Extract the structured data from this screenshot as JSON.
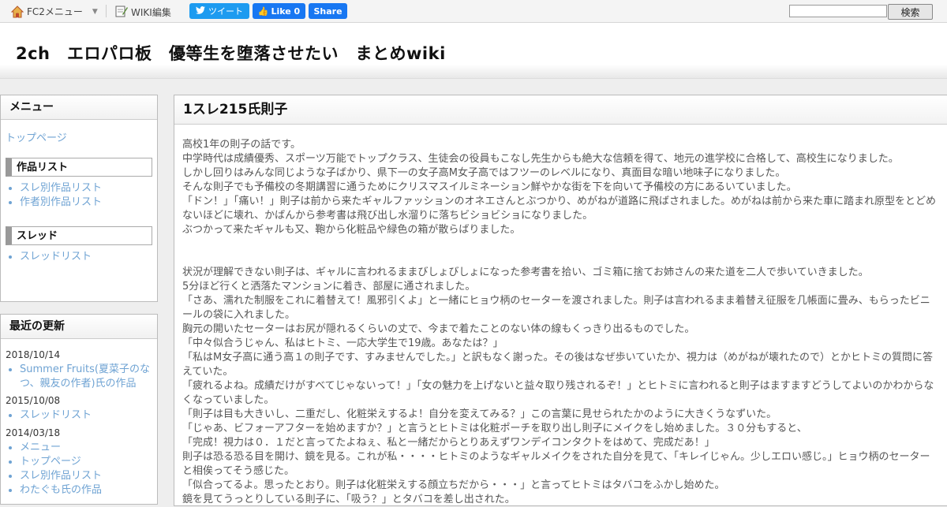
{
  "topbar": {
    "fc2menu_label": "FC2メニュー",
    "wiki_edit_label": "WIKI編集",
    "tweet_label": "ツイート",
    "like_label": "Like 0",
    "share_label": "Share",
    "search_value": "",
    "search_button_label": "検索"
  },
  "header": {
    "site_title": "2ch　エロパロ板　優等生を堕落させたい　まとめwiki"
  },
  "sidebar": {
    "menu_title": "メニュー",
    "top_page_link": "トップページ",
    "works_heading": "作品リスト",
    "works_links": [
      "スレ別作品リスト",
      "作者別作品リスト"
    ],
    "thread_heading": "スレッド",
    "thread_links": [
      "スレッドリスト"
    ],
    "recent_title": "最近の更新",
    "recent": [
      {
        "date": "2018/10/14",
        "items": [
          "Summer Fruits(夏菜子のなつ、親友の作者)氏の作品"
        ]
      },
      {
        "date": "2015/10/08",
        "items": [
          "スレッドリスト"
        ]
      },
      {
        "date": "2014/03/18",
        "items": [
          "メニュー",
          "トップページ",
          "スレ別作品リスト",
          "わたぐも氏の作品"
        ]
      }
    ]
  },
  "main": {
    "title": "1スレ215氏則子",
    "paragraphs_a": [
      "高校1年の則子の話です。",
      "中学時代は成績優秀、スポーツ万能でトップクラス、生徒会の役員もこなし先生からも絶大な信頼を得て、地元の進学校に合格して、高校生になりました。",
      "しかし回りはみんな同じような子ばかり、県下一の女子高M女子高ではフツーのレベルになり、真面目な暗い地味子になりました。",
      "そんな則子でも予備校の冬期講習に通うためにクリスマスイルミネーション鮮やかな街を下を向いて予備校の方にあるいていました。",
      "「ドン！」「痛い！」則子は前から来たギャルファッションのオネエさんとぶつかり、めがねが道路に飛ばされました。めがねは前から来た車に踏まれ原型をとどめないほどに壊れ、かばんから参考書は飛び出し水溜りに落ちビショビショになりました。",
      "ぶつかって来たギャルも又、鞄から化粧品や緑色の箱が散らばりました。"
    ],
    "paragraphs_b": [
      "状況が理解できない則子は、ギャルに言われるままびしょびしょになった参考書を拾い、ゴミ箱に捨てお姉さんの来た道を二人で歩いていきました。",
      "5分ほど行くと洒落たマンションに着き、部屋に通されました。",
      "「さあ、濡れた制服をこれに着替えて！風邪引くよ」と一緒にヒョウ柄のセーターを渡されました。則子は言われるまま着替え征服を几帳面に畳み、もらったビニールの袋に入れました。",
      "胸元の開いたセーターはお尻が隠れるくらいの丈で、今まで着たことのない体の線もくっきり出るものでした。",
      "「中々似合うじゃん、私はヒトミ、一応大学生で19歳。あなたは？」",
      "「私はM女子高に通う高１の則子です、すみませんでした。」と訳もなく謝った。その後はなぜ歩いていたか、視力は（めがねが壊れたので）とかヒトミの質問に答えていた。",
      "「疲れるよね。成績だけがすべてじゃないって！」「女の魅力を上げないと益々取り残されるぞ！」とヒトミに言われると則子はますますどうしてよいのかわからなくなっていました。",
      "「則子は目も大きいし、二重だし、化粧栄えするよ！自分を変えてみる？」この言葉に見せられたかのように大きくうなずいた。",
      "「じゃあ、ビフォーアフターを始めますか？」と言うとヒトミは化粧ポーチを取り出し則子にメイクをし始めました。３０分もすると、",
      "「完成！視力は０．１だと言ってたよねぇ、私と一緒だからとりあえずワンデイコンタクトをはめて、完成だあ！」",
      "則子は恐る恐る目を開け、鏡を見る。これが私・・・・ヒトミのようなギャルメイクをされた自分を見て、「キレイじゃん。少しエロい感じ。」ヒョウ柄のセーターと相俟ってそう感じた。",
      "「似合ってるよ。思ったとおり。則子は化粧栄えする顔立ちだから・・・」と言ってヒトミはタバコをふかし始めた。",
      "鏡を見てうっとりしている則子に、「吸う？」とタバコを差し出された。"
    ]
  }
}
